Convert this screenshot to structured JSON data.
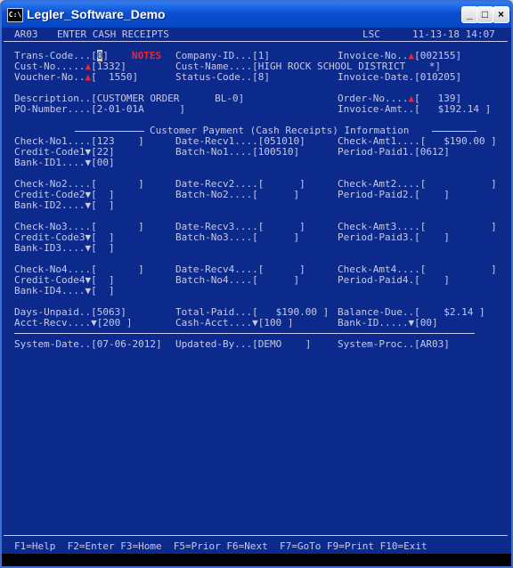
{
  "window": {
    "title": "Legler_Software_Demo",
    "icon": "C:\\"
  },
  "header": {
    "prog": "AR03",
    "screen_title": "ENTER CASH RECEIPTS",
    "user": "LSC",
    "date_time": "11-13-18 14:07"
  },
  "trans": {
    "label": "Trans-Code...[",
    "value": "0",
    "close": "]",
    "notes": "NOTES"
  },
  "company": {
    "label": "Company-ID...[1]"
  },
  "invoice_no": {
    "label": "Invoice-No..",
    "value": "[002155]"
  },
  "cust_no": {
    "label": "Cust-No.....",
    "value": "[1332]"
  },
  "cust_name": {
    "label": "Cust-Name....[HIGH ROCK SCHOOL DISTRICT    *]"
  },
  "voucher": {
    "label": "Voucher-No..",
    "value": "[  1550]"
  },
  "status": {
    "label": "Status-Code..[8]"
  },
  "invoice_date": {
    "label": "Invoice-Date.[010205]"
  },
  "description": {
    "label": "Description..[CUSTOMER ORDER      BL-0]"
  },
  "order_no": {
    "label": "Order-No....",
    "value": "[   139]"
  },
  "po_number": {
    "label": "PO-Number....[2-01-01A      ]"
  },
  "invoice_amt": {
    "label": "Invoice-Amt..[   $192.14 ]"
  },
  "section_title": "Customer Payment (Cash Receipts) Information",
  "payments": [
    {
      "check": "Check-No1....[123    ]",
      "date": "Date-Recv1....[051010]",
      "amt": "Check-Amt1....[   $190.00 ]",
      "credit": "Credit-Code1",
      "credit_val": "[22]",
      "batch": "Batch-No1....[100510]",
      "period": "Period-Paid1.[0612]",
      "bank": "Bank-ID1....",
      "bank_val": "[00]"
    },
    {
      "check": "Check-No2....[       ]",
      "date": "Date-Recv2....[      ]",
      "amt": "Check-Amt2....[           ]",
      "credit": "Credit-Code2",
      "credit_val": "[  ]",
      "batch": "Batch-No2....[      ]",
      "period": "Period-Paid2.[    ]",
      "bank": "Bank-ID2....",
      "bank_val": "[  ]"
    },
    {
      "check": "Check-No3....[       ]",
      "date": "Date-Recv3....[      ]",
      "amt": "Check-Amt3....[           ]",
      "credit": "Credit-Code3",
      "credit_val": "[  ]",
      "batch": "Batch-No3....[      ]",
      "period": "Period-Paid3.[    ]",
      "bank": "Bank-ID3....",
      "bank_val": "[  ]"
    },
    {
      "check": "Check-No4....[       ]",
      "date": "Date-Recv4....[      ]",
      "amt": "Check-Amt4....[           ]",
      "credit": "Credit-Code4",
      "credit_val": "[  ]",
      "batch": "Batch-No4....[      ]",
      "period": "Period-Paid4.[    ]",
      "bank": "Bank-ID4....",
      "bank_val": "[  ]"
    }
  ],
  "totals": {
    "days_unpaid": "Days-Unpaid..[5063]",
    "total_paid": "Total-Paid...[   $190.00 ]",
    "balance_due": "Balance-Due..[    $2.14 ]",
    "acct_recv": "Acct-Recv....",
    "acct_recv_val": "[200 ]",
    "cash_acct": "Cash-Acct....",
    "cash_acct_val": "[100 ]",
    "bank_id": "Bank-ID.....",
    "bank_id_val": "[00]"
  },
  "system": {
    "date": "System-Date..[07-06-2012]",
    "updated_by": "Updated-By...[DEMO    ]",
    "proc": "System-Proc..[AR03]"
  },
  "fkeys": "F1=Help  F2=Enter F3=Home  F5=Prior F6=Next  F7=GoTo F9=Print F10=Exit",
  "glyphs": {
    "up": "▲",
    "down": "▼"
  }
}
